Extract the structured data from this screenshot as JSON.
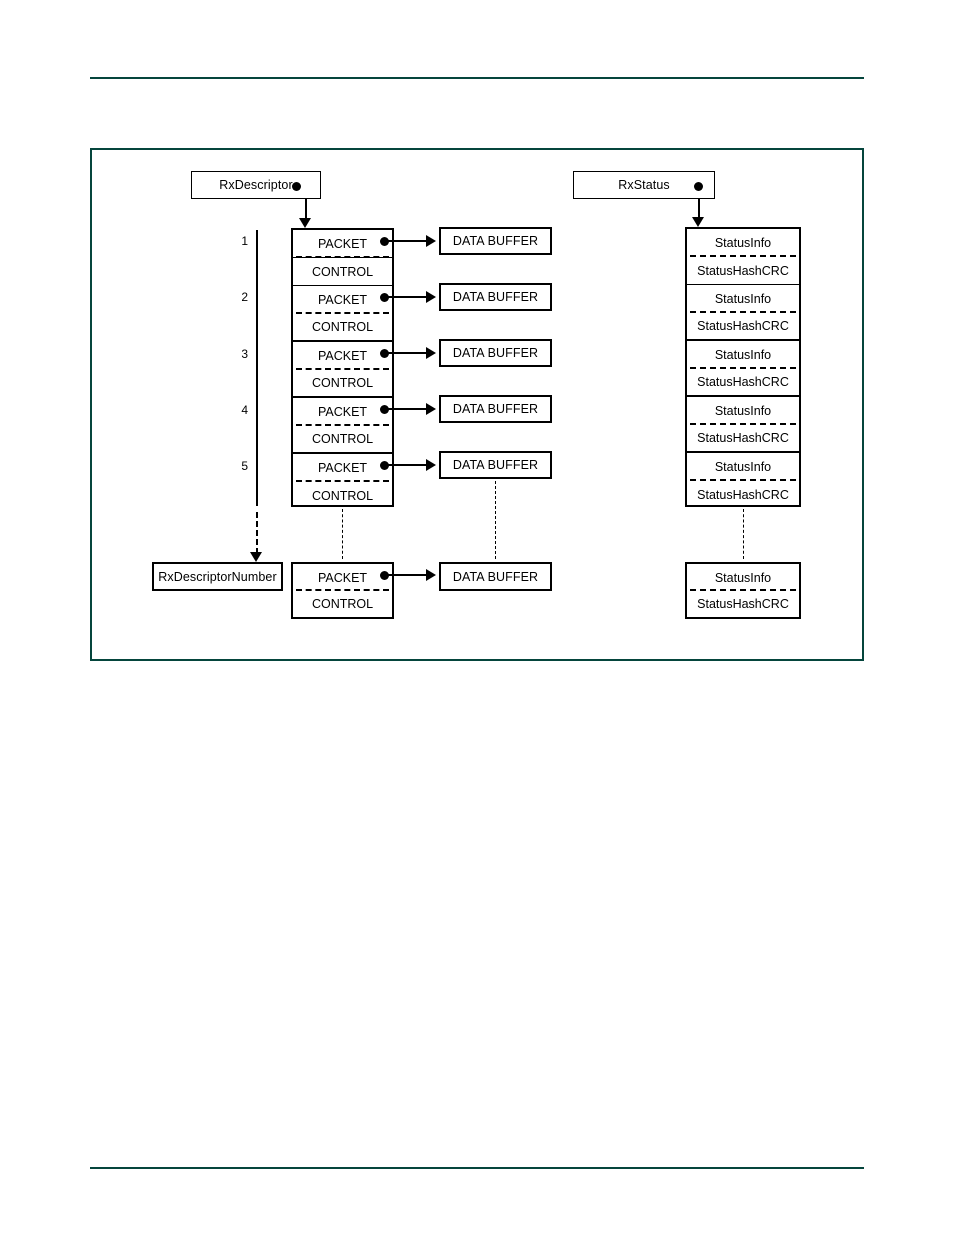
{
  "colors": {
    "rule": "#05453c",
    "frame": "#05453c",
    "stroke": "#000000"
  },
  "diagram": {
    "descriptor_pointer": {
      "label": "RxDescriptor"
    },
    "status_pointer": {
      "label": "RxStatus"
    },
    "descriptor_number": {
      "label": "RxDescriptorNumber"
    },
    "index_labels": [
      "1",
      "2",
      "3",
      "4",
      "5"
    ],
    "descriptor_cells": {
      "packet": "PACKET",
      "control": "CONTROL"
    },
    "status_cells": {
      "info": "StatusInfo",
      "hashcrc": "StatusHashCRC"
    },
    "data_buffer": {
      "label": "DATA BUFFER"
    },
    "descriptors": [
      {
        "index": "1",
        "packet": "PACKET",
        "control": "CONTROL",
        "buffer": "DATA BUFFER"
      },
      {
        "index": "2",
        "packet": "PACKET",
        "control": "CONTROL",
        "buffer": "DATA BUFFER"
      },
      {
        "index": "3",
        "packet": "PACKET",
        "control": "CONTROL",
        "buffer": "DATA BUFFER"
      },
      {
        "index": "4",
        "packet": "PACKET",
        "control": "CONTROL",
        "buffer": "DATA BUFFER"
      },
      {
        "index": "5",
        "packet": "PACKET",
        "control": "CONTROL",
        "buffer": "DATA BUFFER"
      }
    ],
    "descriptor_last": {
      "packet": "PACKET",
      "control": "CONTROL",
      "buffer": "DATA BUFFER"
    },
    "status_entries": [
      {
        "info": "StatusInfo",
        "hashcrc": "StatusHashCRC"
      },
      {
        "info": "StatusInfo",
        "hashcrc": "StatusHashCRC"
      },
      {
        "info": "StatusInfo",
        "hashcrc": "StatusHashCRC"
      },
      {
        "info": "StatusInfo",
        "hashcrc": "StatusHashCRC"
      },
      {
        "info": "StatusInfo",
        "hashcrc": "StatusHashCRC"
      }
    ],
    "status_last": {
      "info": "StatusInfo",
      "hashcrc": "StatusHashCRC"
    }
  }
}
